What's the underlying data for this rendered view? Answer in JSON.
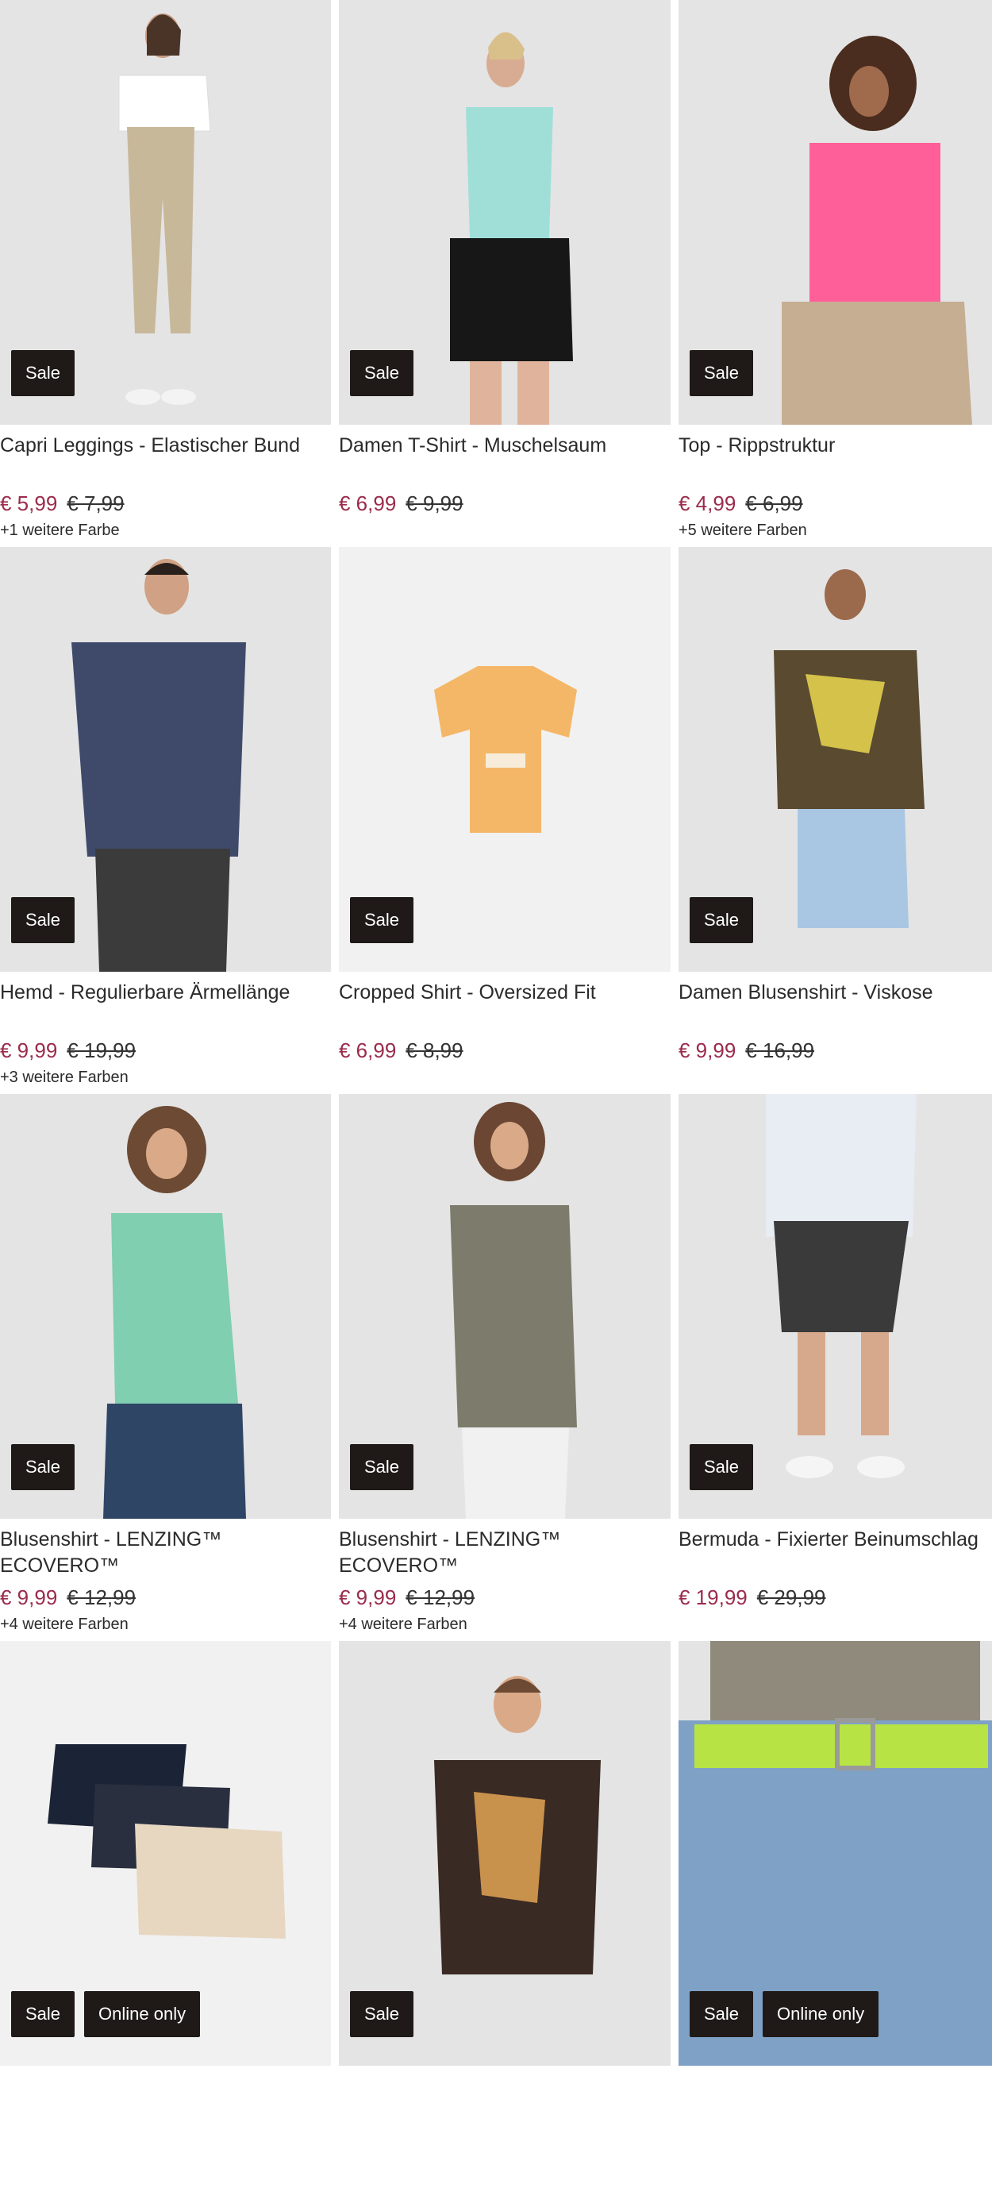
{
  "products": [
    {
      "title": "Capri Leggings - Elastischer Bund",
      "price": "€ 5,99",
      "old_price": "€ 7,99",
      "colors": "+1 weitere Farbe",
      "badges": [
        "Sale"
      ]
    },
    {
      "title": "Damen T-Shirt - Muschelsaum",
      "price": "€ 6,99",
      "old_price": "€ 9,99",
      "colors": "",
      "badges": [
        "Sale"
      ]
    },
    {
      "title": "Top - Rippstruktur",
      "price": "€ 4,99",
      "old_price": "€ 6,99",
      "colors": "+5 weitere Farben",
      "badges": [
        "Sale"
      ]
    },
    {
      "title": "Hemd - Regulierbare Ärmellänge",
      "price": "€ 9,99",
      "old_price": "€ 19,99",
      "colors": "+3 weitere Farben",
      "badges": [
        "Sale"
      ]
    },
    {
      "title": "Cropped Shirt - Oversized Fit",
      "price": "€ 6,99",
      "old_price": "€ 8,99",
      "colors": "",
      "badges": [
        "Sale"
      ]
    },
    {
      "title": "Damen Blusenshirt - Viskose",
      "price": "€ 9,99",
      "old_price": "€ 16,99",
      "colors": "",
      "badges": [
        "Sale"
      ]
    },
    {
      "title": "Blusenshirt - LENZING™ ECOVERO™",
      "price": "€ 9,99",
      "old_price": "€ 12,99",
      "colors": "+4 weitere Farben",
      "badges": [
        "Sale"
      ]
    },
    {
      "title": "Blusenshirt - LENZING™ ECOVERO™",
      "price": "€ 9,99",
      "old_price": "€ 12,99",
      "colors": "+4 weitere Farben",
      "badges": [
        "Sale"
      ]
    },
    {
      "title": "Bermuda - Fixierter Beinumschlag",
      "price": "€ 19,99",
      "old_price": "€ 29,99",
      "colors": "",
      "badges": [
        "Sale"
      ]
    },
    {
      "title": "",
      "price": "",
      "old_price": "",
      "colors": "",
      "badges": [
        "Sale",
        "Online only"
      ]
    },
    {
      "title": "",
      "price": "",
      "old_price": "",
      "colors": "",
      "badges": [
        "Sale"
      ]
    },
    {
      "title": "",
      "price": "",
      "old_price": "",
      "colors": "",
      "badges": [
        "Sale",
        "Online only"
      ]
    }
  ],
  "colors": {
    "sale_price": "#9b2b4c",
    "badge_bg": "#1f1a18",
    "image_bg": "#e4e4e4"
  }
}
